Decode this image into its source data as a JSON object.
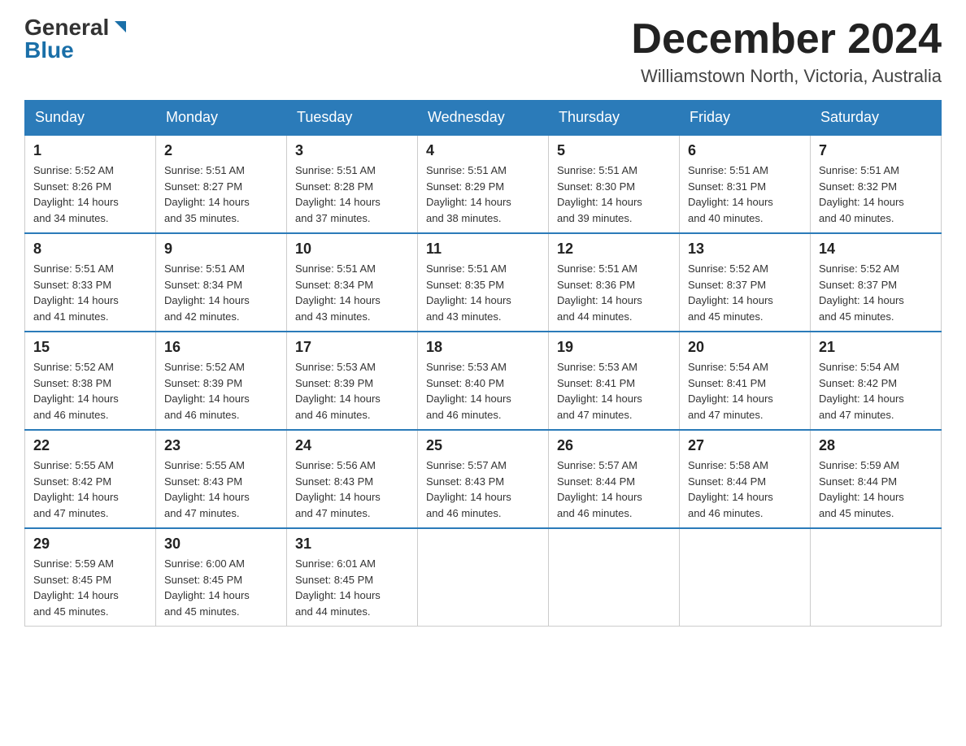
{
  "logo": {
    "general": "General",
    "blue": "Blue"
  },
  "title": {
    "month": "December 2024",
    "location": "Williamstown North, Victoria, Australia"
  },
  "headers": [
    "Sunday",
    "Monday",
    "Tuesday",
    "Wednesday",
    "Thursday",
    "Friday",
    "Saturday"
  ],
  "weeks": [
    [
      {
        "day": "1",
        "sunrise": "5:52 AM",
        "sunset": "8:26 PM",
        "daylight": "14 hours and 34 minutes."
      },
      {
        "day": "2",
        "sunrise": "5:51 AM",
        "sunset": "8:27 PM",
        "daylight": "14 hours and 35 minutes."
      },
      {
        "day": "3",
        "sunrise": "5:51 AM",
        "sunset": "8:28 PM",
        "daylight": "14 hours and 37 minutes."
      },
      {
        "day": "4",
        "sunrise": "5:51 AM",
        "sunset": "8:29 PM",
        "daylight": "14 hours and 38 minutes."
      },
      {
        "day": "5",
        "sunrise": "5:51 AM",
        "sunset": "8:30 PM",
        "daylight": "14 hours and 39 minutes."
      },
      {
        "day": "6",
        "sunrise": "5:51 AM",
        "sunset": "8:31 PM",
        "daylight": "14 hours and 40 minutes."
      },
      {
        "day": "7",
        "sunrise": "5:51 AM",
        "sunset": "8:32 PM",
        "daylight": "14 hours and 40 minutes."
      }
    ],
    [
      {
        "day": "8",
        "sunrise": "5:51 AM",
        "sunset": "8:33 PM",
        "daylight": "14 hours and 41 minutes."
      },
      {
        "day": "9",
        "sunrise": "5:51 AM",
        "sunset": "8:34 PM",
        "daylight": "14 hours and 42 minutes."
      },
      {
        "day": "10",
        "sunrise": "5:51 AM",
        "sunset": "8:34 PM",
        "daylight": "14 hours and 43 minutes."
      },
      {
        "day": "11",
        "sunrise": "5:51 AM",
        "sunset": "8:35 PM",
        "daylight": "14 hours and 43 minutes."
      },
      {
        "day": "12",
        "sunrise": "5:51 AM",
        "sunset": "8:36 PM",
        "daylight": "14 hours and 44 minutes."
      },
      {
        "day": "13",
        "sunrise": "5:52 AM",
        "sunset": "8:37 PM",
        "daylight": "14 hours and 45 minutes."
      },
      {
        "day": "14",
        "sunrise": "5:52 AM",
        "sunset": "8:37 PM",
        "daylight": "14 hours and 45 minutes."
      }
    ],
    [
      {
        "day": "15",
        "sunrise": "5:52 AM",
        "sunset": "8:38 PM",
        "daylight": "14 hours and 46 minutes."
      },
      {
        "day": "16",
        "sunrise": "5:52 AM",
        "sunset": "8:39 PM",
        "daylight": "14 hours and 46 minutes."
      },
      {
        "day": "17",
        "sunrise": "5:53 AM",
        "sunset": "8:39 PM",
        "daylight": "14 hours and 46 minutes."
      },
      {
        "day": "18",
        "sunrise": "5:53 AM",
        "sunset": "8:40 PM",
        "daylight": "14 hours and 46 minutes."
      },
      {
        "day": "19",
        "sunrise": "5:53 AM",
        "sunset": "8:41 PM",
        "daylight": "14 hours and 47 minutes."
      },
      {
        "day": "20",
        "sunrise": "5:54 AM",
        "sunset": "8:41 PM",
        "daylight": "14 hours and 47 minutes."
      },
      {
        "day": "21",
        "sunrise": "5:54 AM",
        "sunset": "8:42 PM",
        "daylight": "14 hours and 47 minutes."
      }
    ],
    [
      {
        "day": "22",
        "sunrise": "5:55 AM",
        "sunset": "8:42 PM",
        "daylight": "14 hours and 47 minutes."
      },
      {
        "day": "23",
        "sunrise": "5:55 AM",
        "sunset": "8:43 PM",
        "daylight": "14 hours and 47 minutes."
      },
      {
        "day": "24",
        "sunrise": "5:56 AM",
        "sunset": "8:43 PM",
        "daylight": "14 hours and 47 minutes."
      },
      {
        "day": "25",
        "sunrise": "5:57 AM",
        "sunset": "8:43 PM",
        "daylight": "14 hours and 46 minutes."
      },
      {
        "day": "26",
        "sunrise": "5:57 AM",
        "sunset": "8:44 PM",
        "daylight": "14 hours and 46 minutes."
      },
      {
        "day": "27",
        "sunrise": "5:58 AM",
        "sunset": "8:44 PM",
        "daylight": "14 hours and 46 minutes."
      },
      {
        "day": "28",
        "sunrise": "5:59 AM",
        "sunset": "8:44 PM",
        "daylight": "14 hours and 45 minutes."
      }
    ],
    [
      {
        "day": "29",
        "sunrise": "5:59 AM",
        "sunset": "8:45 PM",
        "daylight": "14 hours and 45 minutes."
      },
      {
        "day": "30",
        "sunrise": "6:00 AM",
        "sunset": "8:45 PM",
        "daylight": "14 hours and 45 minutes."
      },
      {
        "day": "31",
        "sunrise": "6:01 AM",
        "sunset": "8:45 PM",
        "daylight": "14 hours and 44 minutes."
      },
      null,
      null,
      null,
      null
    ]
  ],
  "labels": {
    "sunrise": "Sunrise:",
    "sunset": "Sunset:",
    "daylight": "Daylight:"
  }
}
